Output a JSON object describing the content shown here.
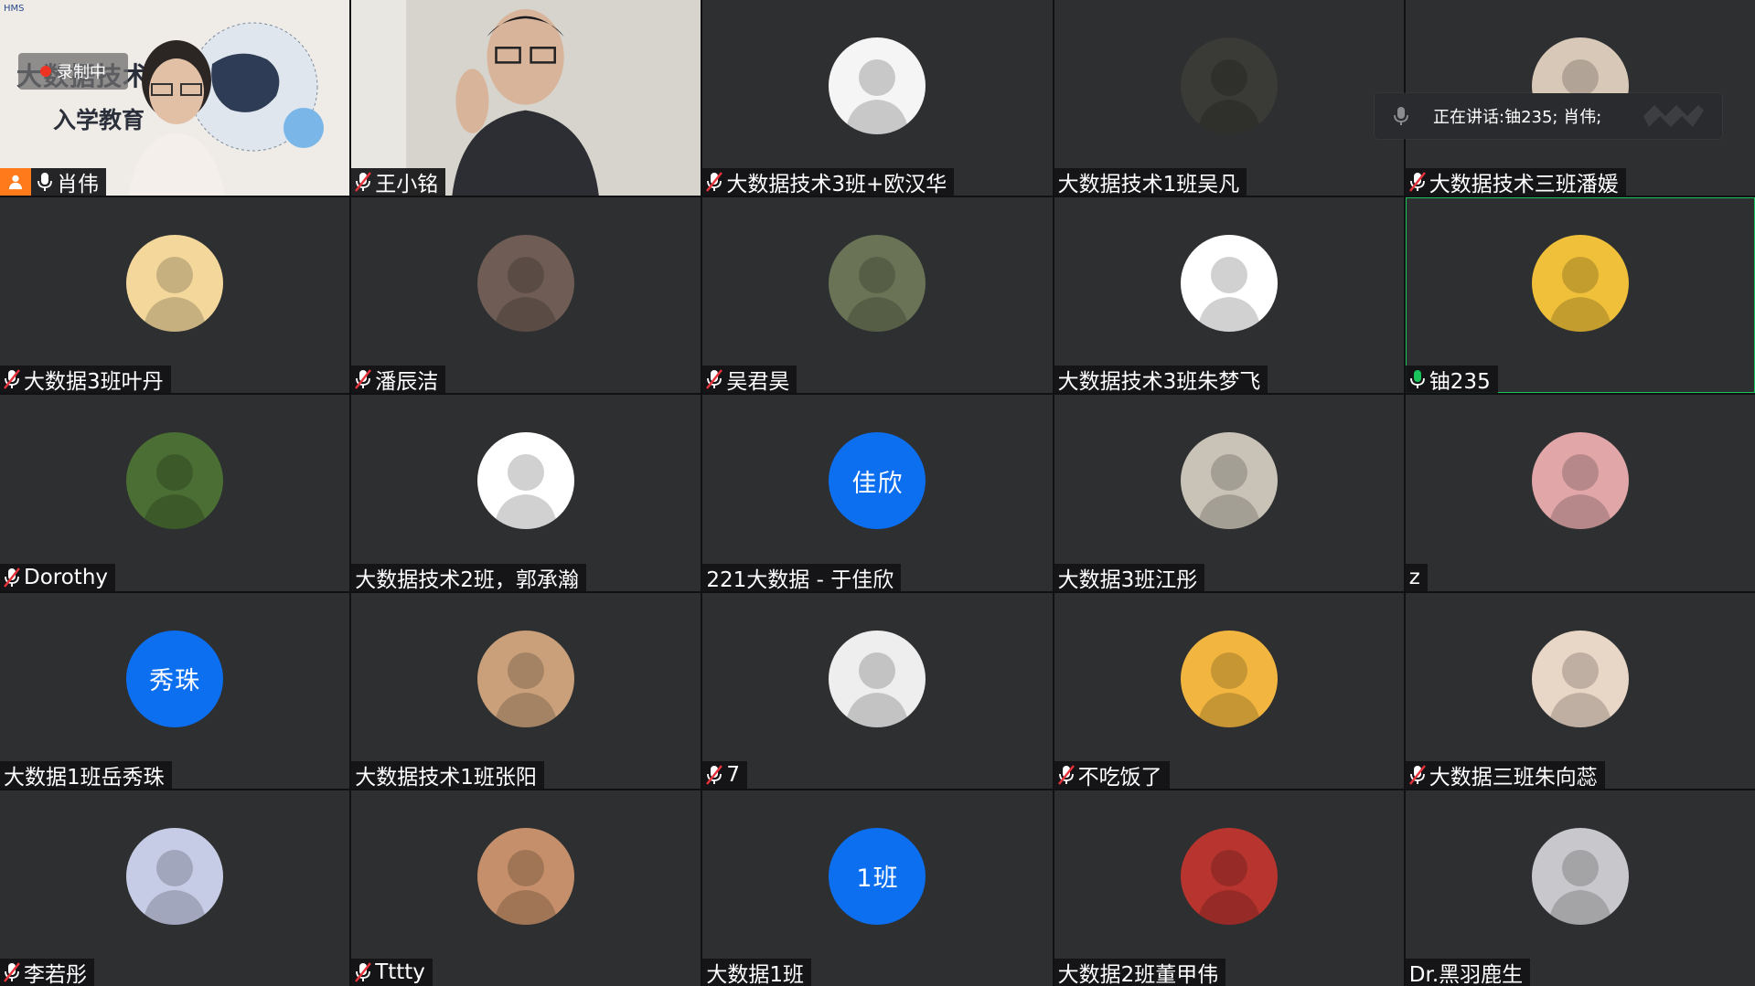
{
  "active_speaker": {
    "prefix": "正在讲话: ",
    "names": "铀235; 肖伟;"
  },
  "video_slide": {
    "logo_text": "HMS",
    "recording_label": "录制中",
    "title": "大数据技术专",
    "subtitle": "入学教育"
  },
  "colors": {
    "tile_bg": "#2e2f31",
    "avatar_blue": "#0c6ff0",
    "speaking_green": "#19c45a",
    "host_orange": "#ff7a1a",
    "mic_muted_red": "#e8323a"
  },
  "participants": [
    {
      "name": "肖伟",
      "mic": "on",
      "host": true,
      "tile": "video-a"
    },
    {
      "name": "王小铭",
      "mic": "muted",
      "tile": "video-b"
    },
    {
      "name": "大数据技术3班+欧汉华",
      "mic": "muted",
      "avatar": "#f5f5f5"
    },
    {
      "name": "大数据技术1班吴凡",
      "mic": "none",
      "avatar": "#3a3a36"
    },
    {
      "name": "大数据技术三班潘媛",
      "mic": "muted",
      "avatar": "#d8c8b8"
    },
    {
      "name": "大数据3班叶丹",
      "mic": "muted",
      "avatar": "#f3d79b"
    },
    {
      "name": "潘辰洁",
      "mic": "muted",
      "avatar": "#6e5c55"
    },
    {
      "name": "吴君昊",
      "mic": "muted",
      "avatar": "#6a7355"
    },
    {
      "name": "大数据技术3班朱梦飞",
      "mic": "none",
      "avatar": "#ffffff"
    },
    {
      "name": "铀235",
      "mic": "speaking",
      "speaking": true,
      "avatar": "#f0c03a"
    },
    {
      "name": "Dorothy",
      "mic": "muted",
      "avatar": "#4a6e33"
    },
    {
      "name": "大数据技术2班，郭承瀚",
      "mic": "none",
      "avatar": "#ffffff"
    },
    {
      "name": "221大数据 - 于佳欣",
      "mic": "none",
      "letters": "佳欣"
    },
    {
      "name": "大数据3班江彤",
      "mic": "none",
      "avatar": "#c9c2b6"
    },
    {
      "name": "z",
      "mic": "none",
      "avatar": "#e0a6a8"
    },
    {
      "name": "大数据1班岳秀珠",
      "mic": "none",
      "letters": "秀珠"
    },
    {
      "name": "大数据技术1班张阳",
      "mic": "none",
      "avatar": "#c9a07a"
    },
    {
      "name": "7",
      "mic": "muted",
      "avatar": "#eeeeee"
    },
    {
      "name": "不吃饭了",
      "mic": "muted",
      "avatar": "#f2b640"
    },
    {
      "name": "大数据三班朱向蕊",
      "mic": "muted",
      "avatar": "#e8d6c6"
    },
    {
      "name": "李若彤",
      "mic": "muted",
      "avatar": "#c6cbe6"
    },
    {
      "name": "Tttty",
      "mic": "muted",
      "avatar": "#c48f6a"
    },
    {
      "name": "大数据1班",
      "mic": "none",
      "letters": "1班"
    },
    {
      "name": "大数据2班董甲伟",
      "mic": "none",
      "avatar": "#b8342f"
    },
    {
      "name": "Dr.黑羽鹿生",
      "mic": "none",
      "avatar": "#c8c8cc"
    }
  ]
}
